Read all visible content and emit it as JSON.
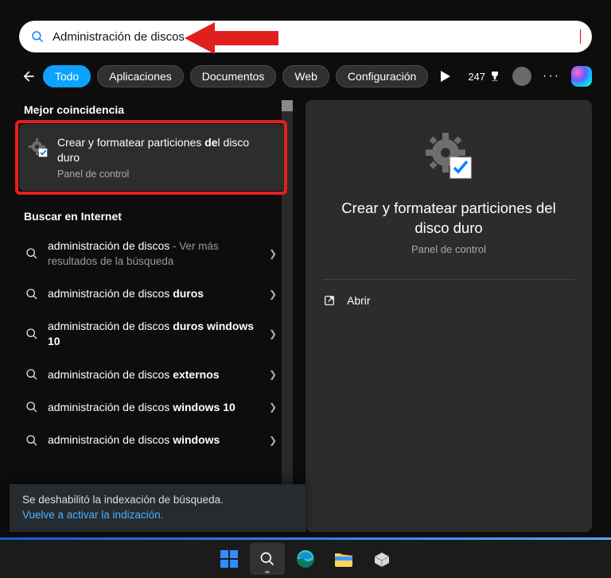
{
  "search": {
    "value": "Administración de discos",
    "placeholder": ""
  },
  "tabs": {
    "todo": "Todo",
    "aplicaciones": "Aplicaciones",
    "documentos": "Documentos",
    "web": "Web",
    "configuracion": "Configuración"
  },
  "rewards": {
    "points": "247"
  },
  "left": {
    "best_header": "Mejor coincidencia",
    "best": {
      "title_pre": "Crear y formatear particiones ",
      "title_bold": "de",
      "title_post": "l disco duro",
      "sub": "Panel de control"
    },
    "web_header": "Buscar en Internet",
    "items": [
      {
        "pre": "administración de discos",
        "bold": "",
        "post": "",
        "suffix": " - Ver más resultados de la búsqueda"
      },
      {
        "pre": "administración de discos ",
        "bold": "duros",
        "post": ""
      },
      {
        "pre": "administración de discos ",
        "bold": "duros windows 10",
        "post": ""
      },
      {
        "pre": "administración de discos ",
        "bold": "externos",
        "post": ""
      },
      {
        "pre": "administración de discos ",
        "bold": "windows 10",
        "post": ""
      },
      {
        "pre": "administración de discos ",
        "bold": "windows",
        "post": ""
      }
    ],
    "index_banner": {
      "line1": "Se deshabilitó la indexación de búsqueda.",
      "line2": "Vuelve a activar la indización."
    }
  },
  "preview": {
    "title": "Crear y formatear particiones del disco duro",
    "sub": "Panel de control",
    "open": "Abrir"
  }
}
